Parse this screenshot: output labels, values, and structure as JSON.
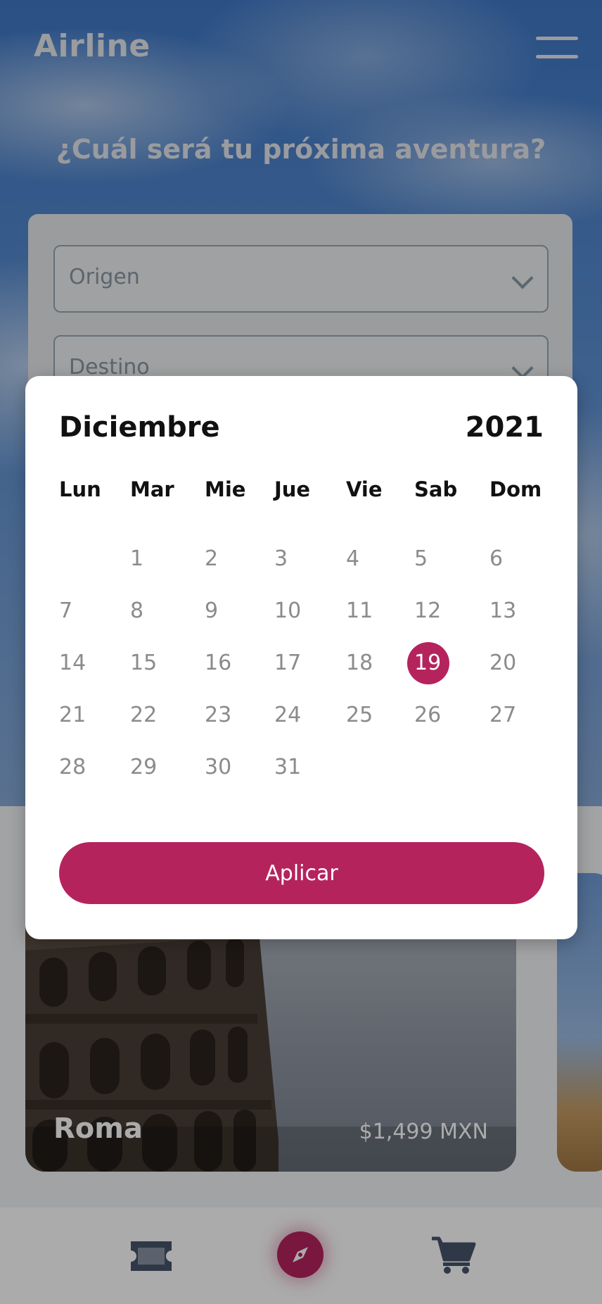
{
  "app": {
    "logo": "Airline"
  },
  "hero": {
    "title": "¿Cuál será tu próxima aventura?"
  },
  "search": {
    "origin_placeholder": "Origen",
    "destination_placeholder": "Destino"
  },
  "calendar": {
    "month": "Diciembre",
    "year": "2021",
    "weekdays": [
      "Lun",
      "Mar",
      "Mie",
      "Jue",
      "Vie",
      "Sab",
      "Dom"
    ],
    "weeks": [
      [
        "",
        "1",
        "2",
        "3",
        "4",
        "5",
        "6"
      ],
      [
        "7",
        "8",
        "9",
        "10",
        "11",
        "12",
        "13"
      ],
      [
        "14",
        "15",
        "16",
        "17",
        "18",
        "19",
        "20"
      ],
      [
        "21",
        "22",
        "23",
        "24",
        "25",
        "26",
        "27"
      ],
      [
        "28",
        "29",
        "30",
        "31",
        "",
        "",
        ""
      ]
    ],
    "selected_day": "19",
    "apply_label": "Aplicar"
  },
  "destinations": [
    {
      "city": "Roma",
      "price": "$1,499 MXN"
    }
  ],
  "nav": {
    "items": [
      {
        "icon": "ticket-icon"
      },
      {
        "icon": "compass-icon",
        "active": true
      },
      {
        "icon": "cart-icon"
      }
    ]
  },
  "colors": {
    "accent": "#b5235d",
    "overlay": "rgba(0,0,0,0.33)"
  }
}
